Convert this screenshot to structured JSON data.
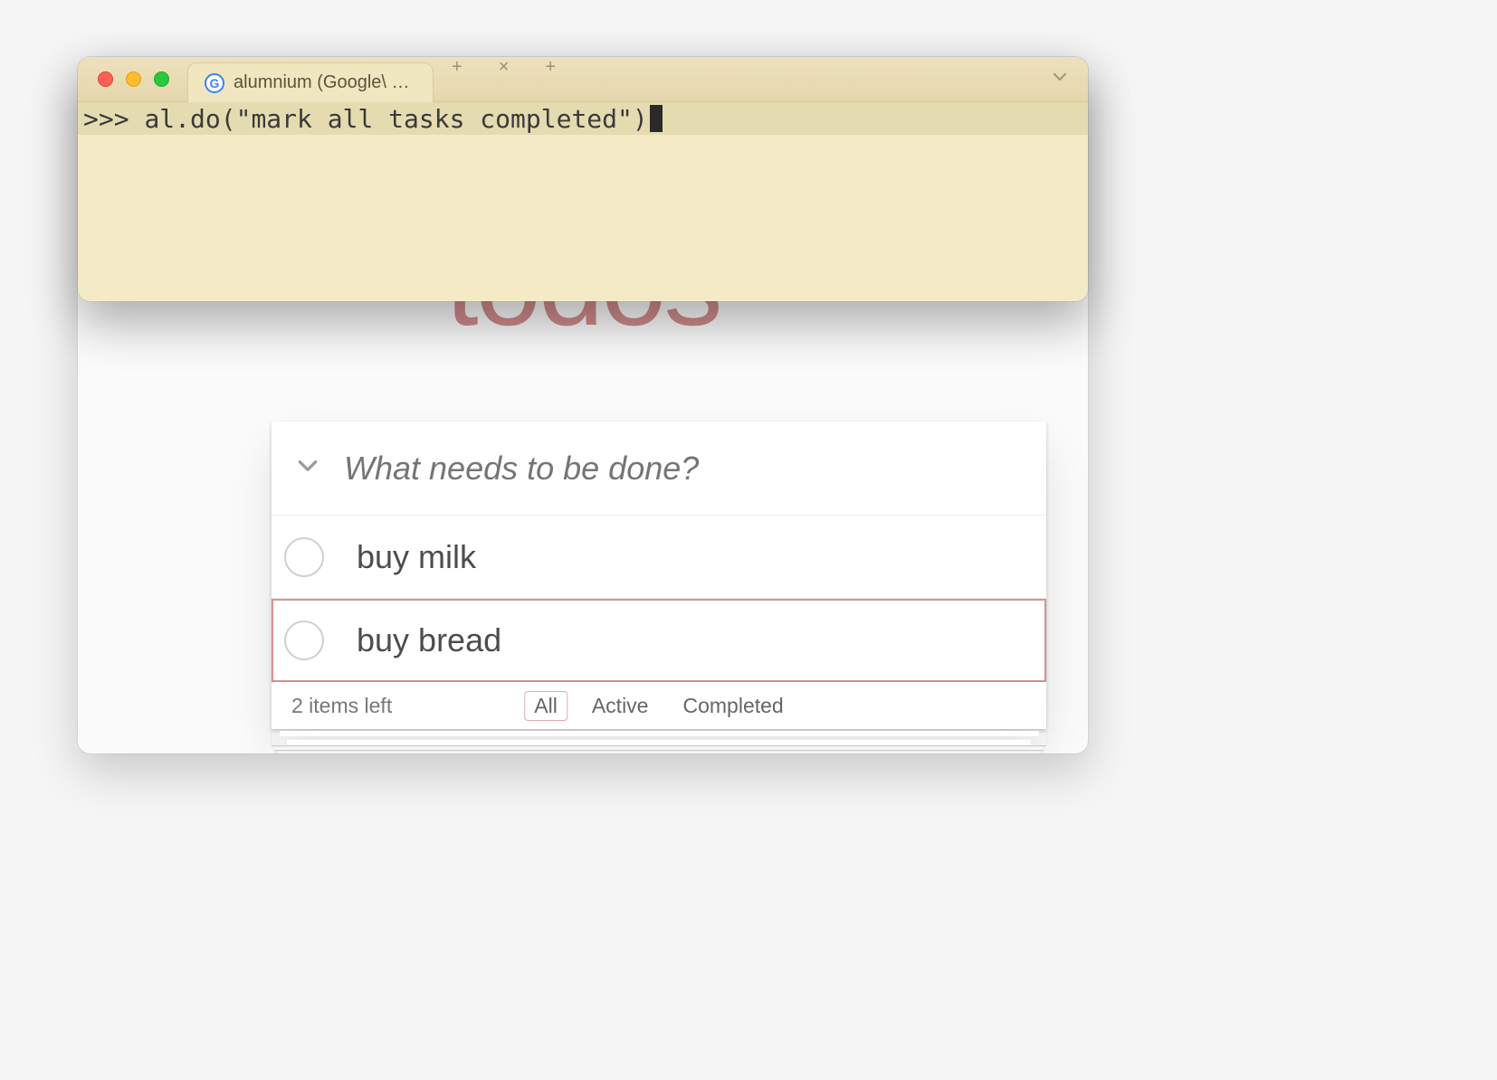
{
  "terminal": {
    "tab_title": "alumnium (Google\\ Chrom…",
    "traffic": {
      "red": "#ff5f57",
      "yellow": "#febc2e",
      "green": "#28c840"
    },
    "prompt": ">>> ",
    "command": "al.do(\"mark all tasks completed\")"
  },
  "todo": {
    "app_title": "todos",
    "input_placeholder": "What needs to be done?",
    "items": [
      {
        "label": "buy milk",
        "completed": false,
        "highlighted": false
      },
      {
        "label": "buy bread",
        "completed": false,
        "highlighted": true
      }
    ],
    "items_left_text": "2 items left",
    "filters": {
      "all": "All",
      "active": "Active",
      "completed": "Completed",
      "selected": "all"
    }
  }
}
